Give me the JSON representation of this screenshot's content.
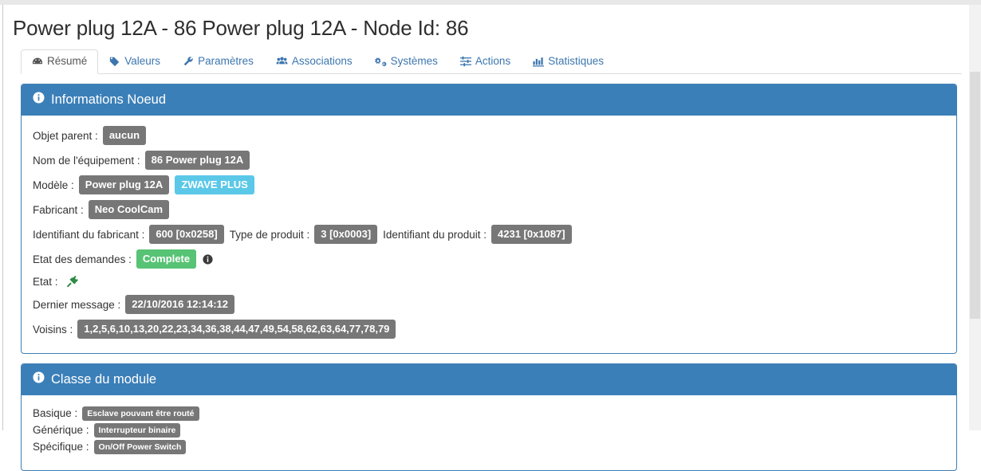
{
  "header": {
    "title": "Power plug 12A - 86 Power plug 12A - Node Id: 86"
  },
  "tabs": [
    {
      "label": "Résumé",
      "icon": "dashboard-icon",
      "active": true
    },
    {
      "label": "Valeurs",
      "icon": "tag-icon",
      "active": false
    },
    {
      "label": "Paramètres",
      "icon": "wrench-icon",
      "active": false
    },
    {
      "label": "Associations",
      "icon": "users-icon",
      "active": false
    },
    {
      "label": "Systèmes",
      "icon": "gears-icon",
      "active": false
    },
    {
      "label": "Actions",
      "icon": "sliders-icon",
      "active": false
    },
    {
      "label": "Statistiques",
      "icon": "bar-chart-icon",
      "active": false
    }
  ],
  "node_info": {
    "panel_title": "Informations Noeud",
    "panel_icon": "info-circle-icon",
    "rows": {
      "parent_label": "Objet parent :",
      "parent_value": "aucun",
      "name_label": "Nom de l'équipement :",
      "name_value": "86 Power plug 12A",
      "model_label": "Modèle :",
      "model_value": "Power plug 12A",
      "model_badge": "ZWAVE PLUS",
      "manufacturer_label": "Fabricant :",
      "manufacturer_value": "Neo CoolCam",
      "manufacturer_id_label": "Identifiant du fabricant :",
      "manufacturer_id_value": "600 [0x0258]",
      "product_type_label": "Type de produit :",
      "product_type_value": "3 [0x0003]",
      "product_id_label": "Identifiant du produit :",
      "product_id_value": "4231 [0x1087]",
      "requests_label": "Etat des demandes :",
      "requests_value": "Complete",
      "state_label": "Etat :",
      "state_icon": "plug-icon",
      "last_message_label": "Dernier message :",
      "last_message_value": "22/10/2016 12:14:12",
      "neighbours_label": "Voisins :",
      "neighbours_value": "1,2,5,6,10,13,20,22,23,34,36,38,44,47,49,54,58,62,63,64,77,78,79"
    }
  },
  "module_class": {
    "panel_title": "Classe du module",
    "panel_icon": "info-circle-icon",
    "rows": {
      "basic_label": "Basique :",
      "basic_value": "Esclave pouvant être routé",
      "generic_label": "Générique :",
      "generic_value": "Interrupteur binaire",
      "specific_label": "Spécifique :",
      "specific_value": "On/Off Power Switch"
    }
  },
  "colors": {
    "panel_header": "#3b7fb8",
    "badge_default": "#777777",
    "badge_info": "#5bc8e8",
    "badge_success": "#57c374",
    "tab_link": "#3c76af",
    "plug_green": "#2f8a46"
  }
}
